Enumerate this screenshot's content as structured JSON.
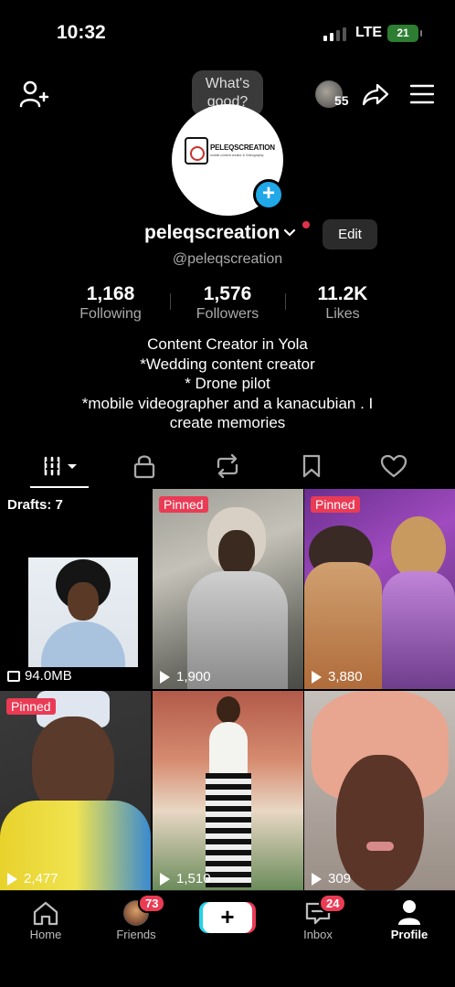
{
  "status_bar": {
    "time": "10:32",
    "network": "LTE",
    "battery": "21"
  },
  "top_bar": {
    "viewer_count": "55"
  },
  "profile": {
    "tooltip": "What's good?",
    "logo_text": "PELEQSCREATION",
    "logo_subtitle": "mobile content creator & Videography",
    "username": "peleqscreation",
    "handle": "@peleqscreation",
    "edit_label": "Edit"
  },
  "stats": [
    {
      "value": "1,168",
      "label": "Following"
    },
    {
      "value": "1,576",
      "label": "Followers"
    },
    {
      "value": "11.2K",
      "label": "Likes"
    }
  ],
  "bio": {
    "line1": "Content Creator in Yola",
    "line2": "*Wedding content creator",
    "line3": "* Drone pilot",
    "line4": "*mobile videographer and a kanacubian   . I",
    "line5": "create memories"
  },
  "tabs": [
    "videos-grid-icon",
    "lock-icon",
    "repost-icon",
    "bookmark-icon",
    "heart-icon"
  ],
  "grid": {
    "drafts_label": "Drafts: 7",
    "drafts_size": "94.0MB",
    "pinned_label": "Pinned",
    "videos": [
      {
        "views": "1,900",
        "pinned": true
      },
      {
        "views": "3,880",
        "pinned": true
      },
      {
        "views": "2,477",
        "pinned": true
      },
      {
        "views": "1,510",
        "pinned": false
      },
      {
        "views": "309",
        "pinned": false
      }
    ]
  },
  "bottom_nav": {
    "home": "Home",
    "friends": "Friends",
    "friends_badge": "73",
    "inbox": "Inbox",
    "inbox_badge": "24",
    "profile": "Profile"
  },
  "colors": {
    "accent_red": "#ea3b55",
    "accent_cyan": "#25d2e8",
    "add_blue": "#20a8e8"
  }
}
